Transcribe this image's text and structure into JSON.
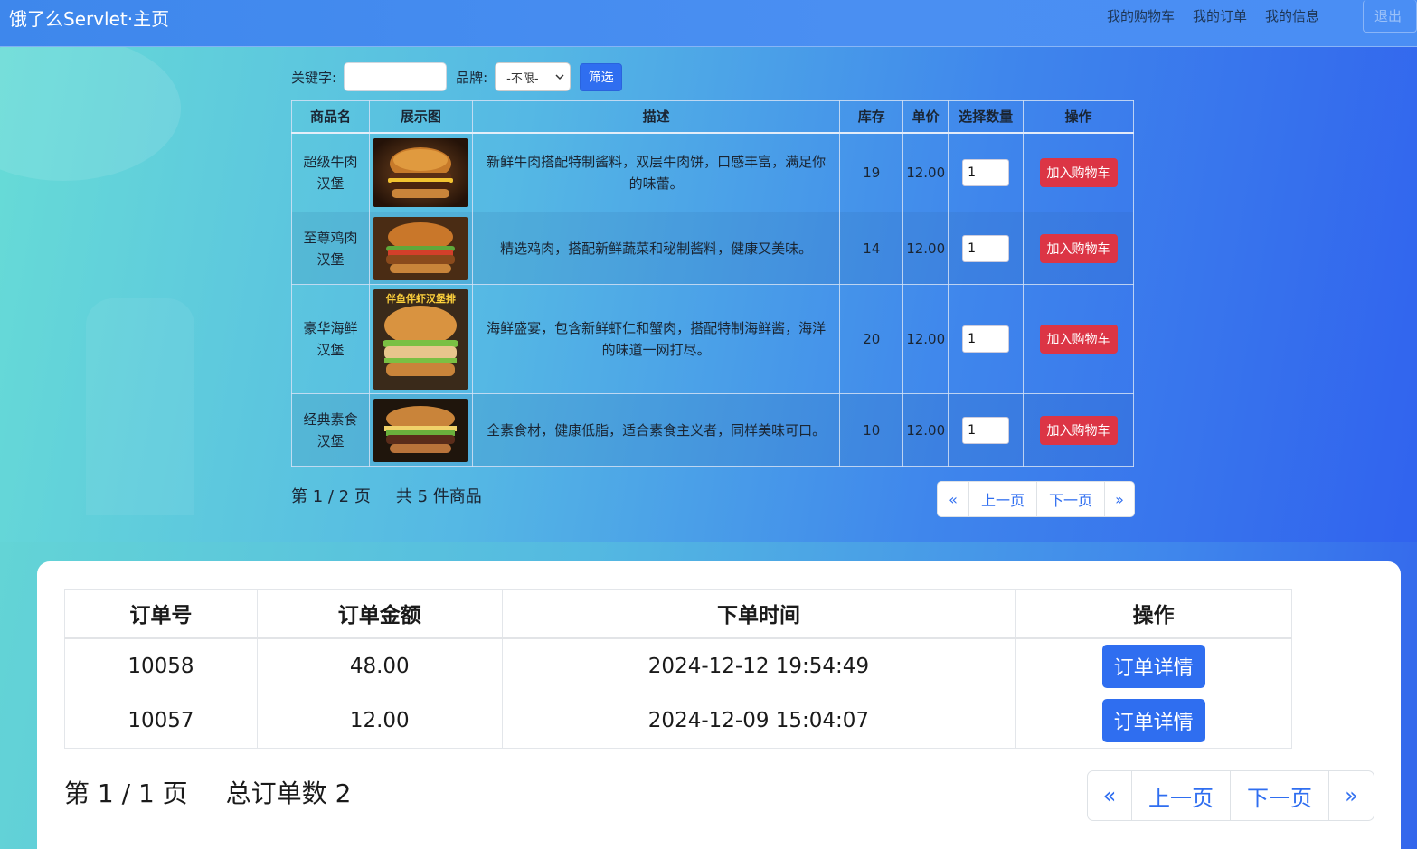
{
  "navbar": {
    "brand": "饿了么Servlet·主页",
    "links": [
      "我的购物车",
      "我的订单",
      "我的信息"
    ],
    "logout": "退出"
  },
  "filter": {
    "keyword_label": "关键字:",
    "keyword_value": "",
    "brand_label": "品牌:",
    "brand_selected": "-不限-",
    "submit_label": "筛选"
  },
  "products": {
    "headers": [
      "商品名",
      "展示图",
      "描述",
      "库存",
      "单价",
      "选择数量",
      "操作"
    ],
    "rows": [
      {
        "name": "超级牛肉汉堡",
        "desc": "新鲜牛肉搭配特制酱料，双层牛肉饼，口感丰富，满足你的味蕾。",
        "stock": "19",
        "price": "12.00",
        "qty": "1",
        "action": "加入购物车",
        "image": "beef-burger-image"
      },
      {
        "name": "至尊鸡肉汉堡",
        "desc": "精选鸡肉，搭配新鲜蔬菜和秘制酱料，健康又美味。",
        "stock": "14",
        "price": "12.00",
        "qty": "1",
        "action": "加入购物车",
        "image": "chicken-burger-image"
      },
      {
        "name": "豪华海鲜汉堡",
        "desc": "海鲜盛宴，包含新鲜虾仁和蟹肉，搭配特制海鲜酱，海洋的味道一网打尽。",
        "stock": "20",
        "price": "12.00",
        "qty": "1",
        "action": "加入购物车",
        "image": "seafood-burger-image",
        "image_caption": "伴鱼伴虾汉堡排"
      },
      {
        "name": "经典素食汉堡",
        "desc": "全素食材，健康低脂，适合素食主义者，同样美味可口。",
        "stock": "10",
        "price": "12.00",
        "qty": "1",
        "action": "加入购物车",
        "image": "veggie-burger-image"
      }
    ],
    "page_info": "第 1 / 2 页",
    "total_info": "共 5 件商品",
    "pager": [
      "«",
      "上一页",
      "下一页",
      "»"
    ]
  },
  "orders": {
    "headers": [
      "订单号",
      "订单金额",
      "下单时间",
      "操作"
    ],
    "rows": [
      {
        "id": "10058",
        "amount": "48.00",
        "time": "2024-12-12 19:54:49",
        "action": "订单详情"
      },
      {
        "id": "10057",
        "amount": "12.00",
        "time": "2024-12-09 15:04:07",
        "action": "订单详情"
      }
    ],
    "page_info": "第 1 / 1 页",
    "total_info": "总订单数 2",
    "pager": [
      "«",
      "上一页",
      "下一页",
      "»"
    ]
  },
  "colors": {
    "primary": "#2f6ef0",
    "danger": "#dc3545",
    "navbar": "#4a8ff2"
  }
}
